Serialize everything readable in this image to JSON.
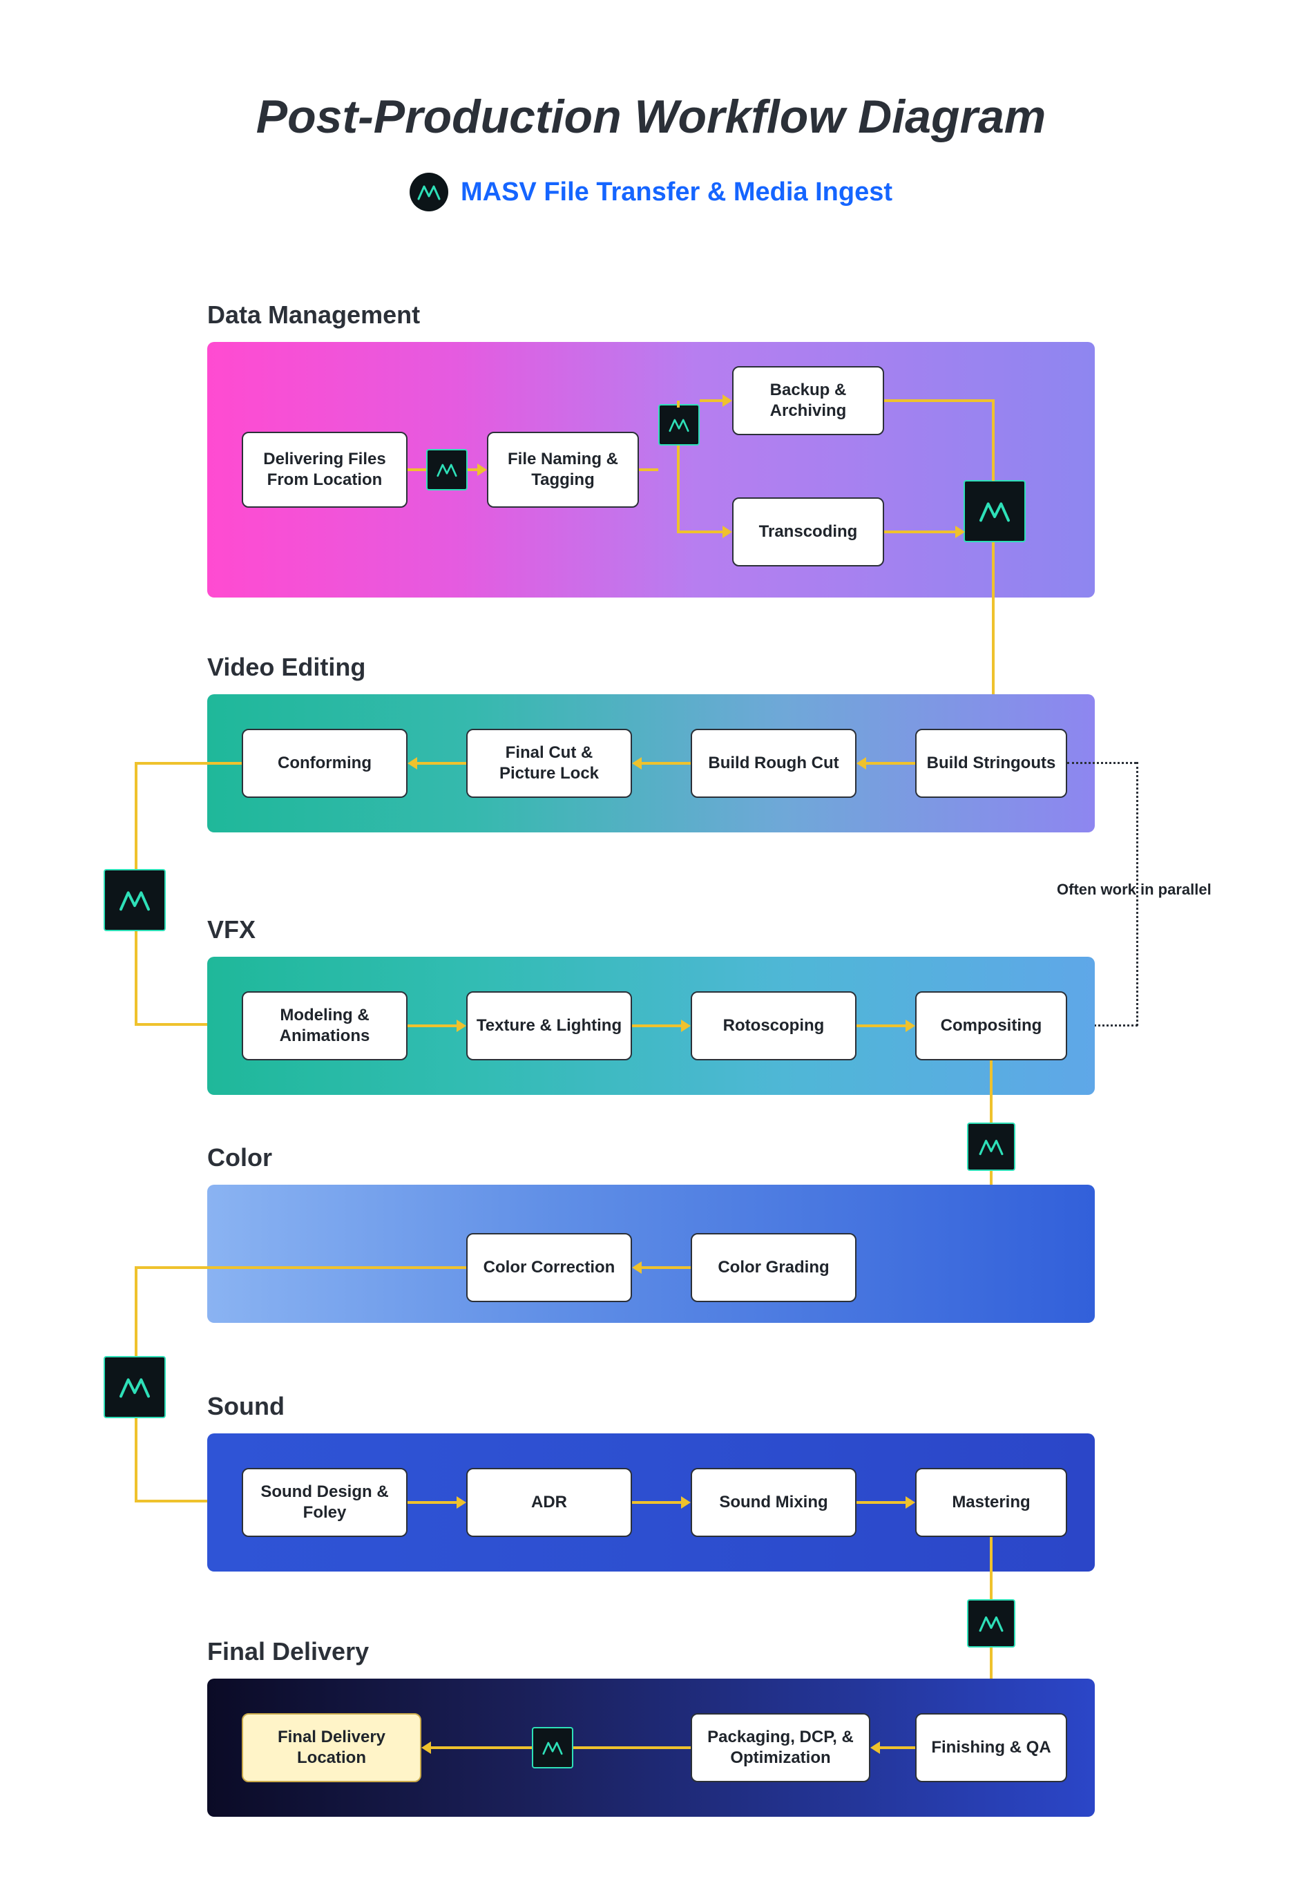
{
  "title": "Post-Production Workflow Diagram",
  "subtitle": "MASV File Transfer & Media Ingest",
  "annotations": {
    "parallel": "Often work in parallel"
  },
  "sections": {
    "data_management": {
      "label": "Data Management",
      "nodes": {
        "deliver": "Delivering Files From Location",
        "naming": "File Naming & Tagging",
        "backup": "Backup & Archiving",
        "transcode": "Transcoding"
      }
    },
    "video_editing": {
      "label": "Video Editing",
      "nodes": {
        "stringouts": "Build Stringouts",
        "rough": "Build Rough Cut",
        "finalcut": "Final Cut & Picture Lock",
        "conforming": "Conforming"
      }
    },
    "vfx": {
      "label": "VFX",
      "nodes": {
        "modeling": "Modeling & Animations",
        "texture": "Texture & Lighting",
        "roto": "Rotoscoping",
        "compositing": "Compositing"
      }
    },
    "color": {
      "label": "Color",
      "nodes": {
        "grading": "Color Grading",
        "correction": "Color Correction"
      }
    },
    "sound": {
      "label": "Sound",
      "nodes": {
        "design": "Sound Design & Foley",
        "adr": "ADR",
        "mixing": "Sound Mixing",
        "mastering": "Mastering"
      }
    },
    "final_delivery": {
      "label": "Final Delivery",
      "nodes": {
        "finishing": "Finishing & QA",
        "packaging": "Packaging, DCP, & Optimization",
        "location": "Final Delivery Location"
      }
    }
  }
}
